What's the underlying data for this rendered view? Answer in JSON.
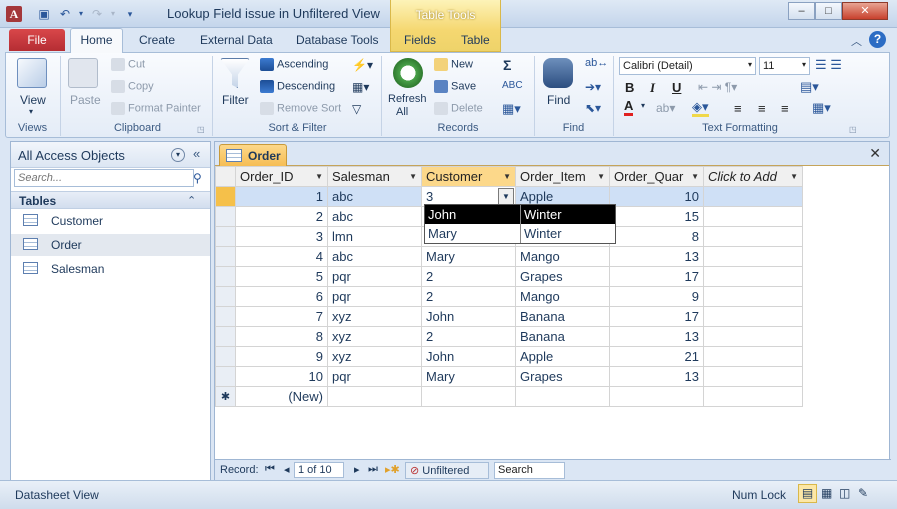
{
  "window": {
    "title": "Lookup Field issue in Unfiltered View",
    "app_icon": "A",
    "contextual_group": "Table Tools",
    "min": "‒",
    "max": "□",
    "close": "✕"
  },
  "tabs": {
    "file": "File",
    "home": "Home",
    "create": "Create",
    "external": "External Data",
    "dbtools": "Database Tools",
    "fields": "Fields",
    "table": "Table"
  },
  "ribbon": {
    "views": {
      "view": "View",
      "label": "Views"
    },
    "clipboard": {
      "paste": "Paste",
      "cut": "Cut",
      "copy": "Copy",
      "format_painter": "Format Painter",
      "label": "Clipboard"
    },
    "sort": {
      "filter": "Filter",
      "ascending": "Ascending",
      "descending": "Descending",
      "remove_sort": "Remove Sort",
      "label": "Sort & Filter"
    },
    "records": {
      "refresh": "Refresh",
      "refresh_sub": "All",
      "new": "New",
      "save": "Save",
      "delete": "Delete",
      "label": "Records"
    },
    "find": {
      "find": "Find",
      "label": "Find"
    },
    "text": {
      "font": "Calibri (Detail)",
      "size": "11",
      "bold": "B",
      "italic": "I",
      "underline": "U",
      "label": "Text Formatting"
    }
  },
  "nav": {
    "title": "All Access Objects",
    "search_placeholder": "Search...",
    "group": "Tables",
    "items": [
      "Customer",
      "Order",
      "Salesman"
    ]
  },
  "document": {
    "tab": "Order"
  },
  "grid": {
    "columns": [
      "Order_ID",
      "Salesman",
      "Customer",
      "Order_Item",
      "Order_Quar",
      "Click to Add"
    ],
    "rows": [
      [
        "1",
        "abc",
        "3",
        "Apple",
        "10"
      ],
      [
        "2",
        "abc",
        "",
        "",
        "15"
      ],
      [
        "3",
        "lmn",
        "",
        "",
        "8"
      ],
      [
        "4",
        "abc",
        "Mary",
        "Mango",
        "13"
      ],
      [
        "5",
        "pqr",
        "2",
        "Grapes",
        "17"
      ],
      [
        "6",
        "pqr",
        "2",
        "Mango",
        "9"
      ],
      [
        "7",
        "xyz",
        "John",
        "Banana",
        "17"
      ],
      [
        "8",
        "xyz",
        "2",
        "Banana",
        "13"
      ],
      [
        "9",
        "xyz",
        "John",
        "Apple",
        "21"
      ],
      [
        "10",
        "pqr",
        "Mary",
        "Grapes",
        "13"
      ]
    ],
    "new_row": "(New)",
    "new_marker": "✱"
  },
  "dropdown": {
    "options": [
      [
        "John",
        "Winter"
      ],
      [
        "Mary",
        "Winter"
      ]
    ]
  },
  "record_nav": {
    "label": "Record:",
    "position": "1 of 10",
    "filter": "Unfiltered",
    "search": "Search"
  },
  "status": {
    "left": "Datasheet View",
    "numlock": "Num Lock"
  }
}
